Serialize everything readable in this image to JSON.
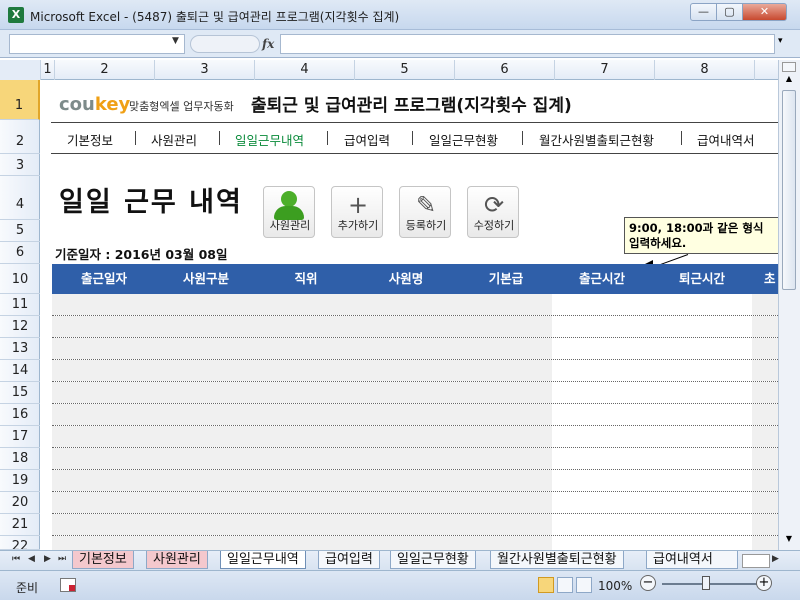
{
  "window": {
    "title": "Microsoft Excel - (5487) 출퇴근 및 급여관리 프로그램(지각횟수 집계)",
    "app_icon": "X"
  },
  "formula_bar": {
    "fx": "fx"
  },
  "columns": [
    "1",
    "2",
    "3",
    "4",
    "5",
    "6",
    "7",
    "8"
  ],
  "rows": [
    "1",
    "2",
    "3",
    "4",
    "5",
    "6",
    "10",
    "11",
    "12",
    "13",
    "14",
    "15",
    "16",
    "17",
    "18",
    "19",
    "20",
    "21",
    "22"
  ],
  "brand": {
    "logo_text": "cou",
    "logo_accent": "key",
    "tagline": "맞춤형엑셀 업무자동화"
  },
  "program_title": "출퇴근 및 급여관리 프로그램(지각횟수 집계)",
  "nav": [
    "기본정보",
    "사원관리",
    "일일근무내역",
    "급여입력",
    "일일근무현황",
    "월간사원별출퇴근현황",
    "급여내역서"
  ],
  "nav_active": "일일근무내역",
  "page_heading": "일일 근무 내역",
  "buttons": {
    "employee": "사원관리",
    "add": "추가하기",
    "register": "등록하기",
    "edit": "수정하기"
  },
  "ref_date": "기준일자 : 2016년 03월 08일",
  "comment": {
    "line1": "9:00, 18:00과 같은 형식",
    "line2": "입력하세요."
  },
  "table": {
    "headers": [
      "출근일자",
      "사원구분",
      "직위",
      "사원명",
      "기본급",
      "출근시간",
      "퇴근시간",
      "초"
    ]
  },
  "sheet_tabs": [
    "기본정보",
    "사원관리",
    "일일근무내역",
    "급여입력",
    "일일근무현황",
    "월간사원별출퇴근현황",
    "급여내역서"
  ],
  "status": {
    "ready": "준비",
    "zoom": "100%"
  },
  "colors": {
    "header_blue": "#2f5fa9",
    "active_green": "#0a8a3a",
    "brand_orange": "#f0a015"
  }
}
